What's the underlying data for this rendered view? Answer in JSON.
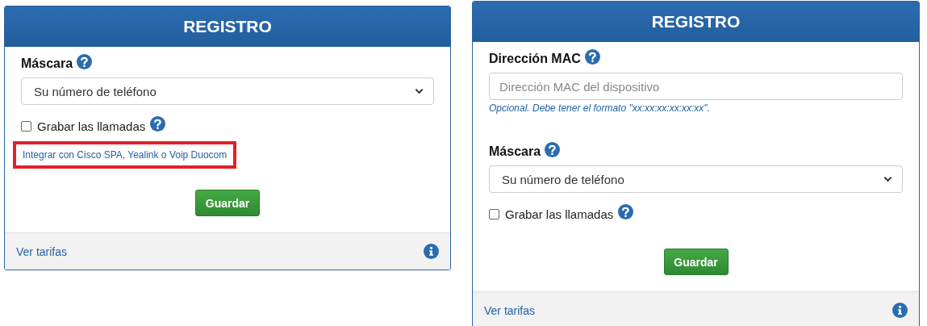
{
  "panels": [
    {
      "title": "REGISTRO",
      "fields": [
        {
          "kind": "select",
          "label": "Máscara",
          "value": "Su número de teléfono"
        },
        {
          "kind": "checkbox",
          "label": "Grabar las llamadas",
          "checked": false
        },
        {
          "kind": "link",
          "text": "Integrar con Cisco SPA, Yealink o Voip Duocom",
          "highlighted": true
        }
      ],
      "button": "Guardar",
      "footer_link": "Ver tarifas"
    },
    {
      "title": "REGISTRO",
      "fields": [
        {
          "kind": "input",
          "label": "Dirección MAC",
          "placeholder": "Dirección MAC del dispositivo",
          "help": "Opcional. Debe tener el formato \"xx:xx:xx:xx:xx:xx\"."
        },
        {
          "kind": "select",
          "label": "Máscara",
          "value": "Su número de teléfono"
        },
        {
          "kind": "checkbox",
          "label": "Grabar las llamadas",
          "checked": false
        }
      ],
      "button": "Guardar",
      "footer_link": "Ver tarifas"
    }
  ]
}
